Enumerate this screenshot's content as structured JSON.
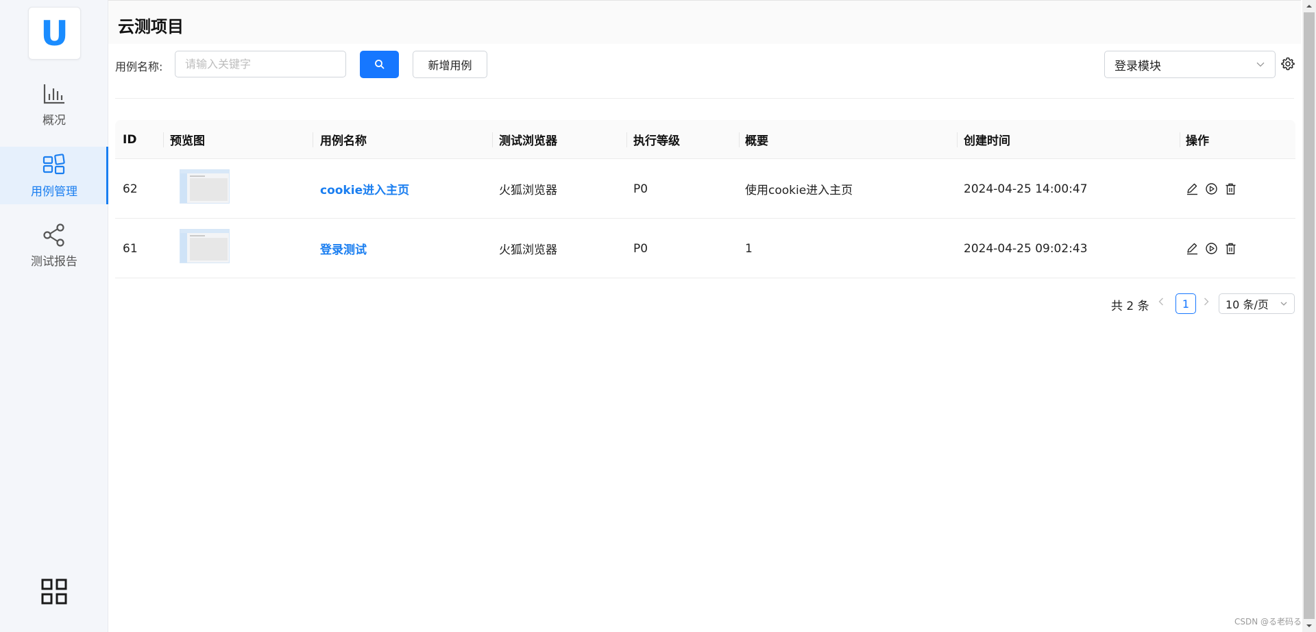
{
  "app": {
    "logo_letter": "U",
    "title": "云测项目"
  },
  "sidebar": {
    "items": [
      {
        "label": "概况",
        "icon": "bar-chart-icon",
        "active": false
      },
      {
        "label": "用例管理",
        "icon": "layout-icon",
        "active": true
      },
      {
        "label": "测试报告",
        "icon": "share-icon",
        "active": false
      }
    ],
    "bottom_icon": "apps-grid-icon"
  },
  "toolbar": {
    "name_label": "用例名称:",
    "search_placeholder": "请输入关键字",
    "search_value": "",
    "add_label": "新增用例",
    "module_value": "登录模块"
  },
  "table": {
    "columns": [
      "ID",
      "预览图",
      "用例名称",
      "测试浏览器",
      "执行等级",
      "概要",
      "创建时间",
      "操作"
    ],
    "rows": [
      {
        "id": "62",
        "name": "cookie进入主页",
        "browser": "火狐浏览器",
        "level": "P0",
        "summary": "使用cookie进入主页",
        "created": "2024-04-25 14:00:47"
      },
      {
        "id": "61",
        "name": "登录测试",
        "browser": "火狐浏览器",
        "level": "P0",
        "summary": "1",
        "created": "2024-04-25 09:02:43"
      }
    ]
  },
  "pagination": {
    "total": "共 2 条",
    "current": "1",
    "page_size": "10 条/页"
  },
  "watermark": "CSDN @る老码る",
  "colors": {
    "accent": "#1677ff",
    "sidebar_bg": "#f4f6fa",
    "active_bg": "#e6f0fc"
  }
}
